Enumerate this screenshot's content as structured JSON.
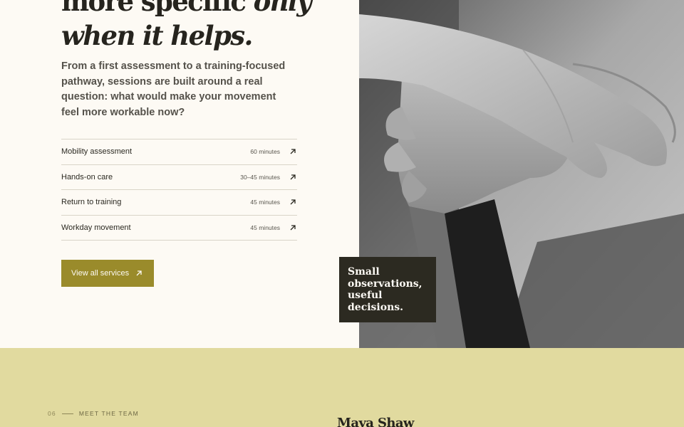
{
  "hero": {
    "heading_line1": "more specific ",
    "heading_line1_em": "only",
    "heading_line2_em": "when it helps."
  },
  "intro": "From a first assessment to a training-focused pathway, sessions are built around a real question: what would make your movement feel more workable now?",
  "services": [
    {
      "name": "Mobility assessment",
      "duration": "60 minutes",
      "icon": "arrow-up-right-icon"
    },
    {
      "name": "Hands-on care",
      "duration": "30–45 minutes",
      "icon": "arrow-up-right-icon"
    },
    {
      "name": "Return to training",
      "duration": "45 minutes",
      "icon": "arrow-up-right-icon"
    },
    {
      "name": "Workday movement",
      "duration": "45 minutes",
      "icon": "arrow-up-right-icon"
    }
  ],
  "cta": {
    "label": "View all services",
    "icon": "arrow-up-right-icon"
  },
  "photo_caption": "Small observations, useful decisions.",
  "team": {
    "eyebrow_number": "06",
    "eyebrow_label": "MEET THE TEAM",
    "member_name": "Maya Shaw"
  },
  "colors": {
    "background": "#fdfaf4",
    "accent_olive": "#9a8b2b",
    "caption_dark": "#2c2a21",
    "team_band": "#e1da9f"
  }
}
